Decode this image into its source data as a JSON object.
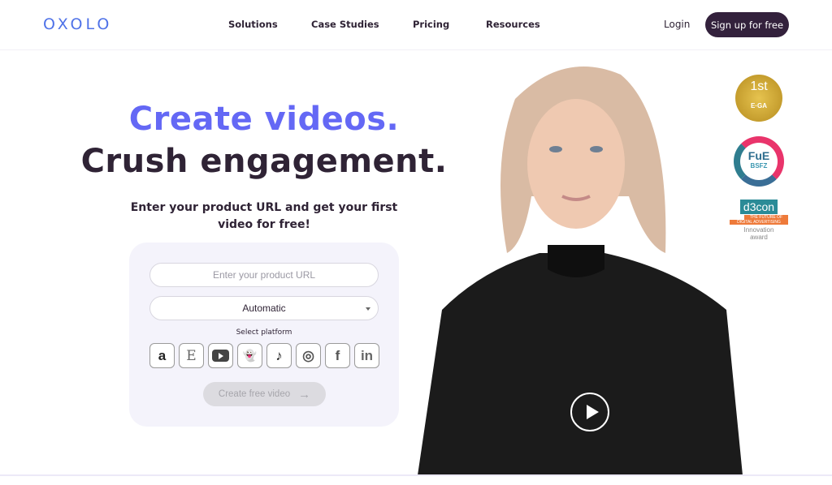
{
  "nav": {
    "logo": "OXOLO",
    "links": [
      "Solutions",
      "Case Studies",
      "Pricing",
      "Resources"
    ],
    "login": "Login",
    "signup": "Sign up for free"
  },
  "hero": {
    "headline_1": "Create videos.",
    "headline_2": "Crush engagement.",
    "subtitle": "Enter your product URL and get your first video for free!"
  },
  "form": {
    "url_placeholder": "Enter your product URL",
    "platform_select": "Automatic",
    "platform_label": "Select platform",
    "platforms": [
      {
        "name": "amazon",
        "glyph": "a"
      },
      {
        "name": "etsy",
        "glyph": "E"
      },
      {
        "name": "youtube",
        "glyph": "▶"
      },
      {
        "name": "snapchat",
        "glyph": "👻"
      },
      {
        "name": "tiktok",
        "glyph": "♪"
      },
      {
        "name": "instagram",
        "glyph": "◎"
      },
      {
        "name": "facebook",
        "glyph": "f"
      },
      {
        "name": "linkedin",
        "glyph": "in"
      }
    ],
    "submit": "Create free video",
    "submit_icon": "→"
  },
  "awards": {
    "ega": {
      "top": "1st",
      "bottom": "E·GA"
    },
    "fue": {
      "title": "FuE",
      "sub": "BSFZ"
    },
    "d3con": {
      "logo": "d3con",
      "tag1": "THE FUTURE OF",
      "tag2": "DIGITAL ADVERTISING",
      "caption": "Innovation award"
    }
  },
  "colors": {
    "accent": "#6468f5",
    "dark": "#33213c",
    "logo": "#4f72e8"
  }
}
